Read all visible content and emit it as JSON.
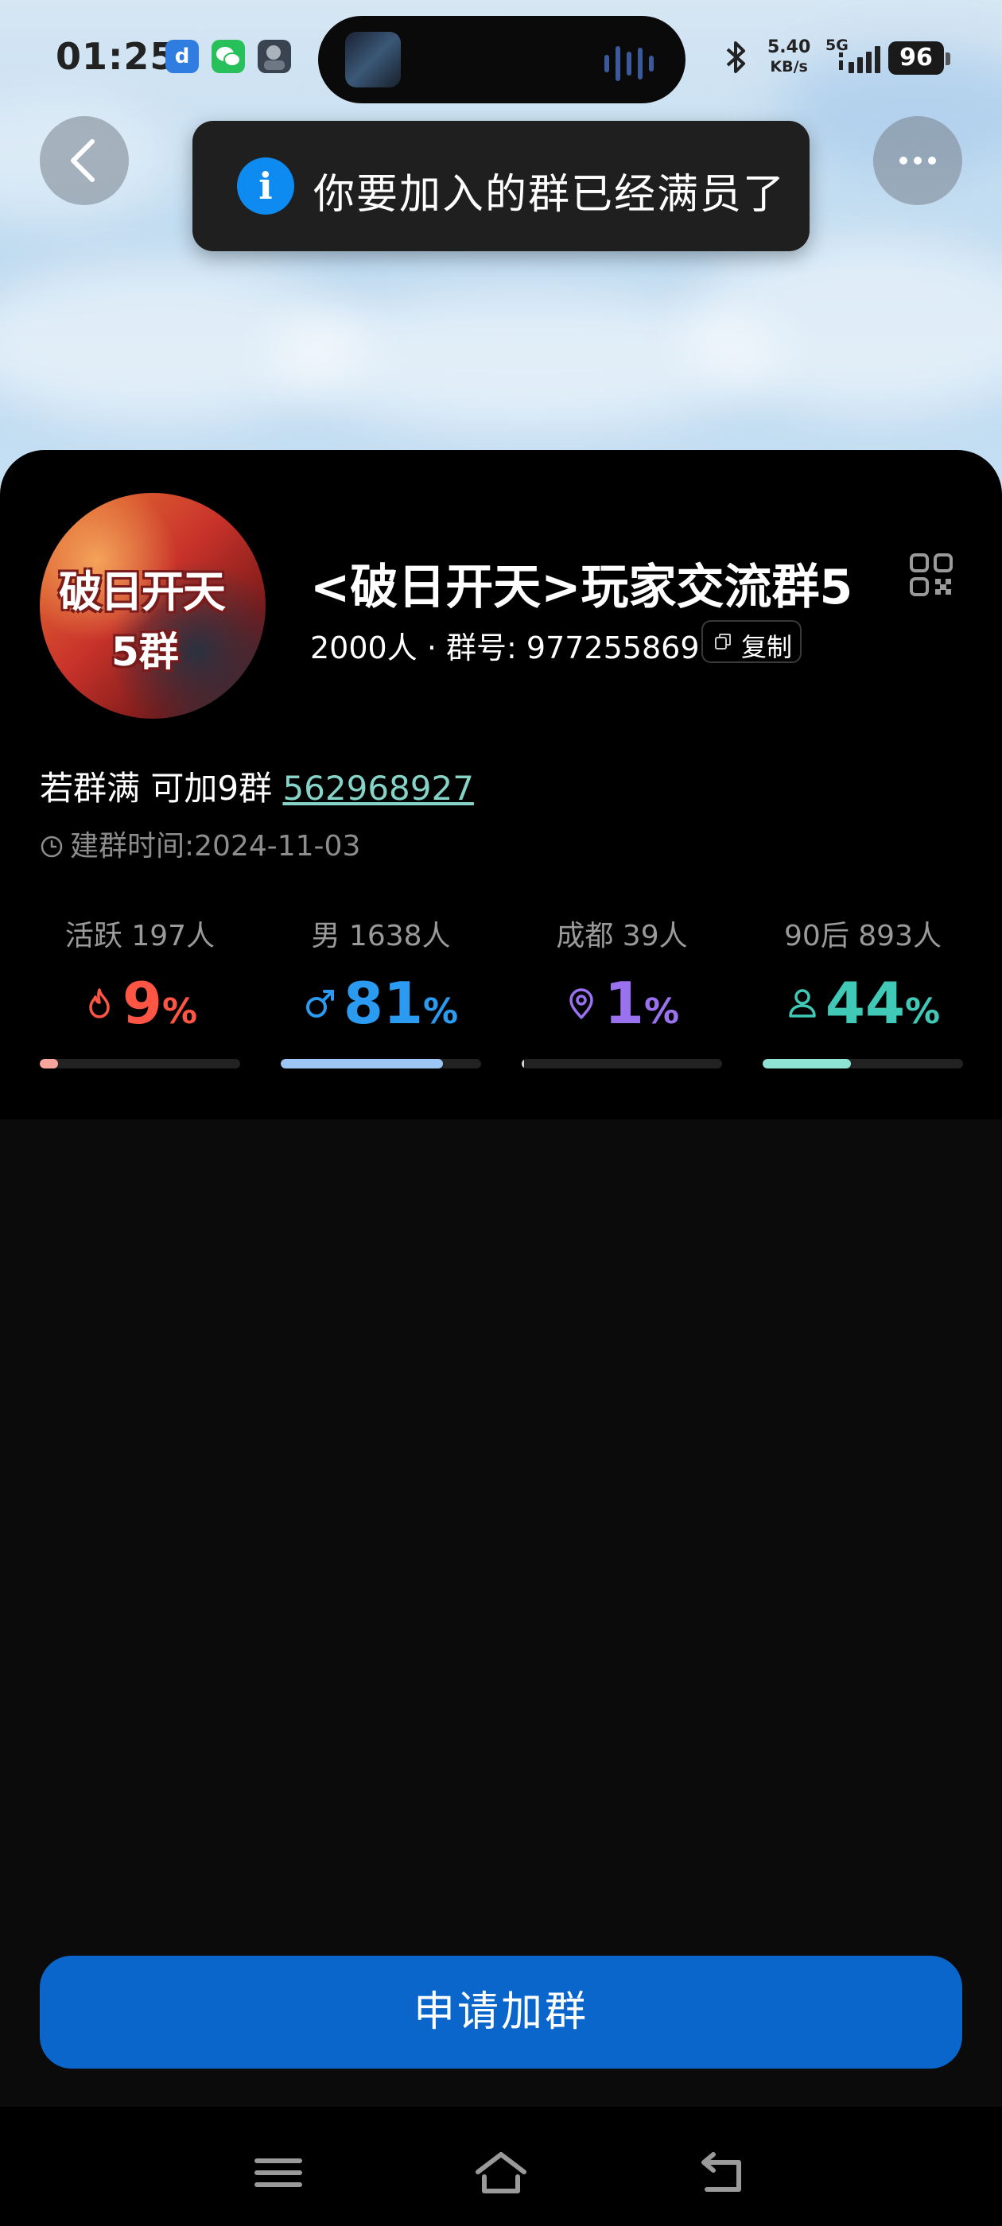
{
  "status_bar": {
    "time": "01:25",
    "app_badge": "d",
    "speed_value": "5.40",
    "speed_unit": "KB/s",
    "network": "5G",
    "battery": "96"
  },
  "toast": {
    "icon": "i",
    "message": "你要加入的群已经满员了"
  },
  "group": {
    "avatar_line1": "破日开天",
    "avatar_line2": "5群",
    "name": "<破日开天>玩家交流群5",
    "member_count": "2000人",
    "separator": "·",
    "group_no_label": "群号:",
    "group_no": "977255869",
    "copy_label": "复制",
    "note_prefix": "若群满 可加9群 ",
    "note_link": "562968927",
    "created_label": "建群时间:",
    "created_date": "2024-11-03"
  },
  "stats": [
    {
      "label": "活跃 197人",
      "value": "9",
      "percent_sign": "%",
      "color": "#ff5544",
      "fill_color": "#f8a59d",
      "fraction": 0.09,
      "icon": "flame-icon"
    },
    {
      "label": "男 1638人",
      "value": "81",
      "percent_sign": "%",
      "color": "#2a9bf0",
      "fill_color": "#9ec6f5",
      "fraction": 0.81,
      "icon": "male-icon"
    },
    {
      "label": "成都 39人",
      "value": "1",
      "percent_sign": "%",
      "color": "#9a72ef",
      "fill_color": "#d6d6d6",
      "fraction": 0.01,
      "icon": "location-pin-icon"
    },
    {
      "label": "90后 893人",
      "value": "44",
      "percent_sign": "%",
      "color": "#3fc9b6",
      "fill_color": "#8ee3d4",
      "fraction": 0.44,
      "icon": "person-icon"
    }
  ],
  "join_button": "申请加群",
  "colors": {
    "accent": "#0b66cc",
    "toast_icon": "#0d8bf0",
    "link": "#86d3c8"
  }
}
